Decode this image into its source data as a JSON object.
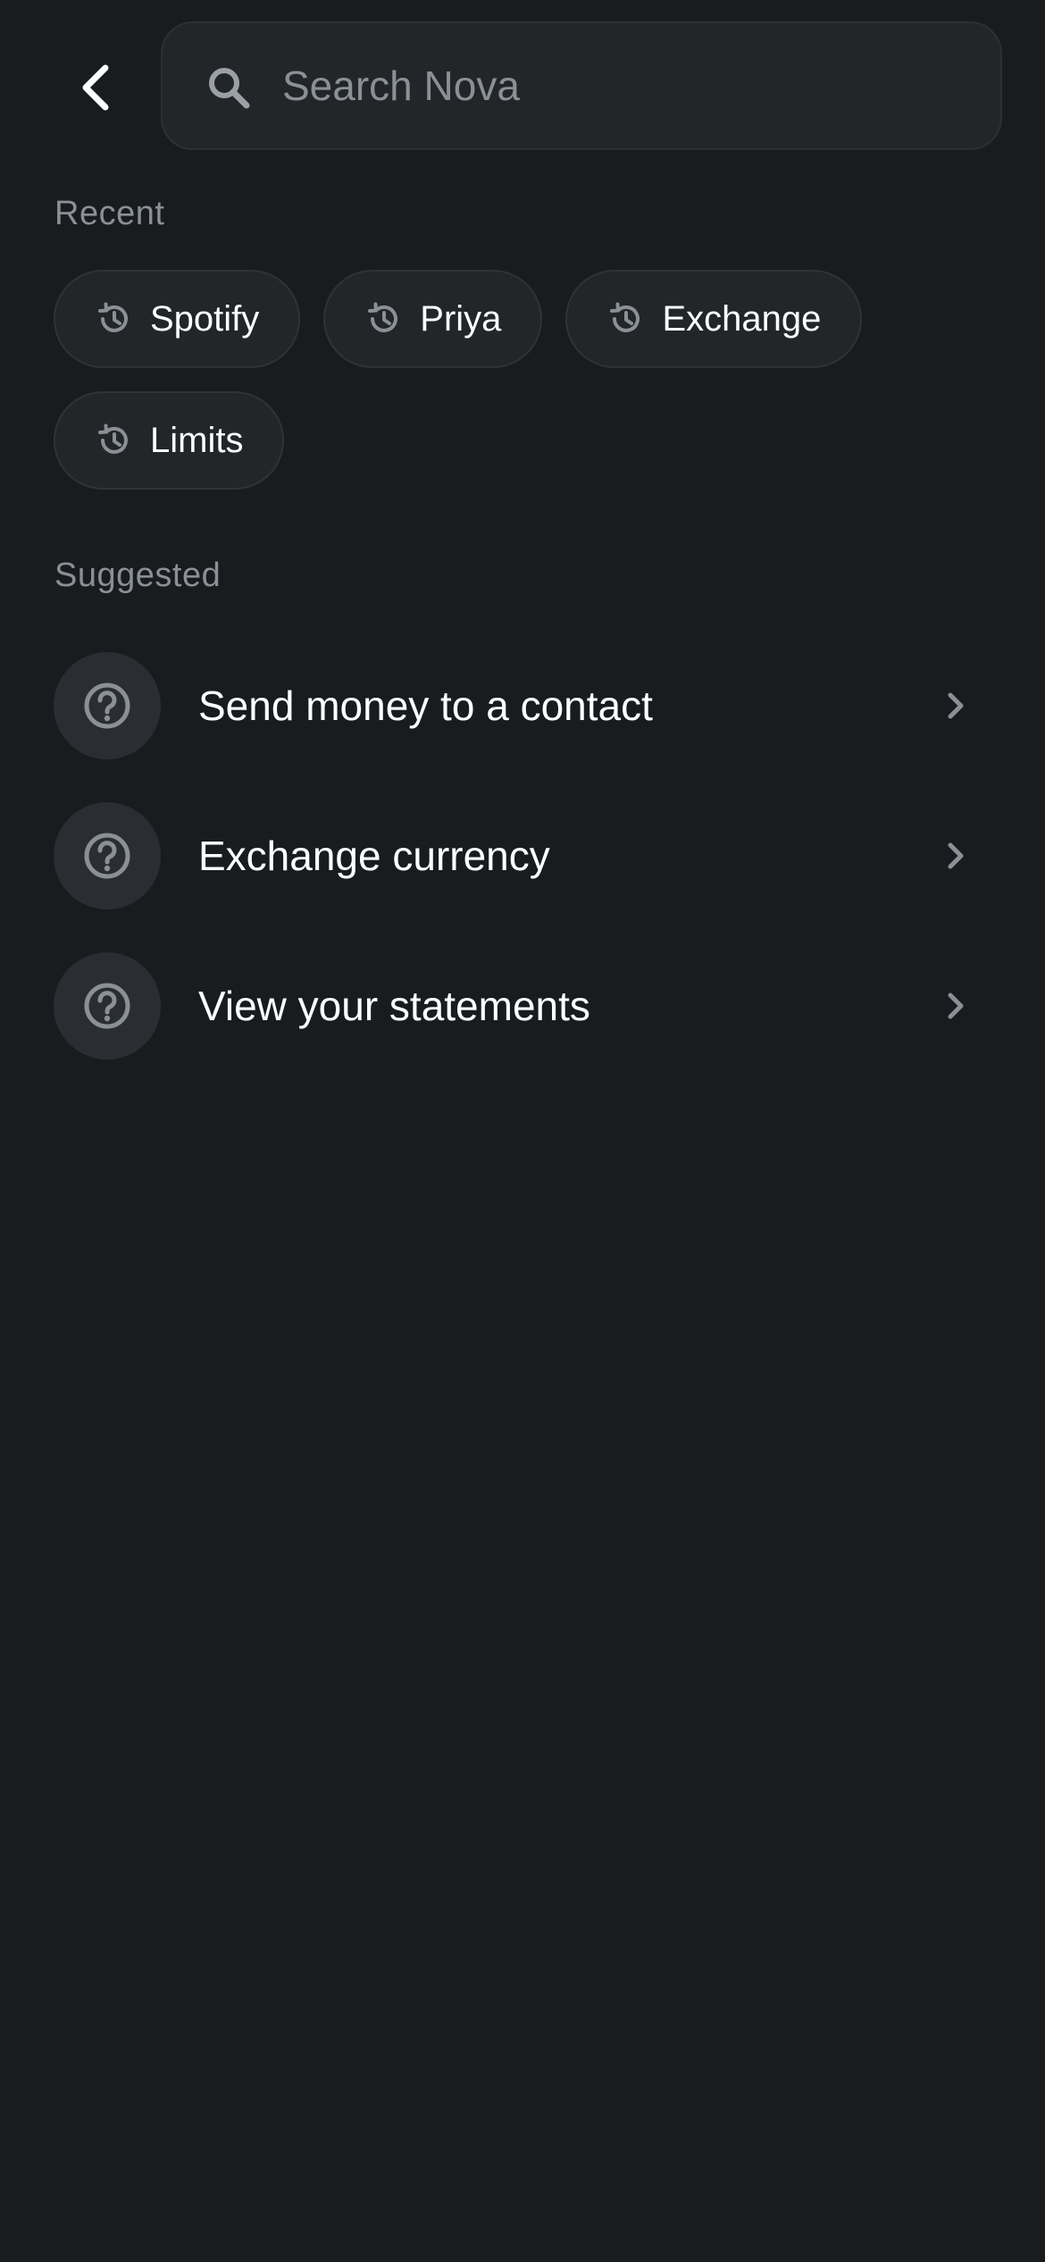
{
  "header": {
    "back_icon": "chevron-left-icon",
    "search_icon": "search-icon",
    "search_placeholder": "Search Nova",
    "search_value": ""
  },
  "recent": {
    "title": "Recent",
    "chip_icon": "history-icon",
    "items": [
      {
        "label": "Spotify"
      },
      {
        "label": "Priya"
      },
      {
        "label": "Exchange"
      },
      {
        "label": "Limits"
      }
    ]
  },
  "suggested": {
    "title": "Suggested",
    "item_icon": "help-circle-icon",
    "chevron_icon": "chevron-right-icon",
    "items": [
      {
        "label": "Send money to a contact"
      },
      {
        "label": "Exchange currency"
      },
      {
        "label": "View your statements"
      }
    ]
  },
  "colors": {
    "background": "#191c1f",
    "surface": "#222629",
    "muted_text": "#8b9096",
    "text": "#ffffff"
  }
}
